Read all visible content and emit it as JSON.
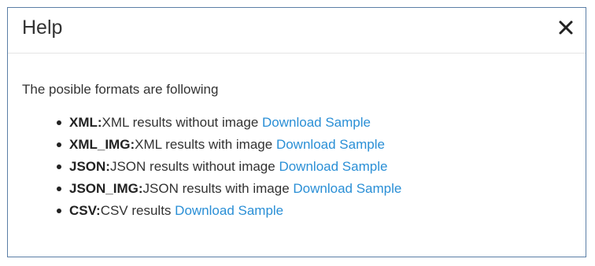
{
  "dialog": {
    "title": "Help",
    "close_icon": "close-icon"
  },
  "body": {
    "intro": "The posible formats are following",
    "formats": [
      {
        "name": "XML:",
        "description": "XML results without image",
        "link": "Download Sample"
      },
      {
        "name": "XML_IMG:",
        "description": "XML results with image",
        "link": "Download Sample"
      },
      {
        "name": "JSON:",
        "description": "JSON results without image",
        "link": "Download Sample"
      },
      {
        "name": "JSON_IMG:",
        "description": "JSON results with image",
        "link": "Download Sample"
      },
      {
        "name": "CSV:",
        "description": "CSV results",
        "link": "Download Sample"
      }
    ]
  },
  "colors": {
    "link": "#2a8fd6",
    "border": "#5b7fa6",
    "text": "#333333"
  }
}
